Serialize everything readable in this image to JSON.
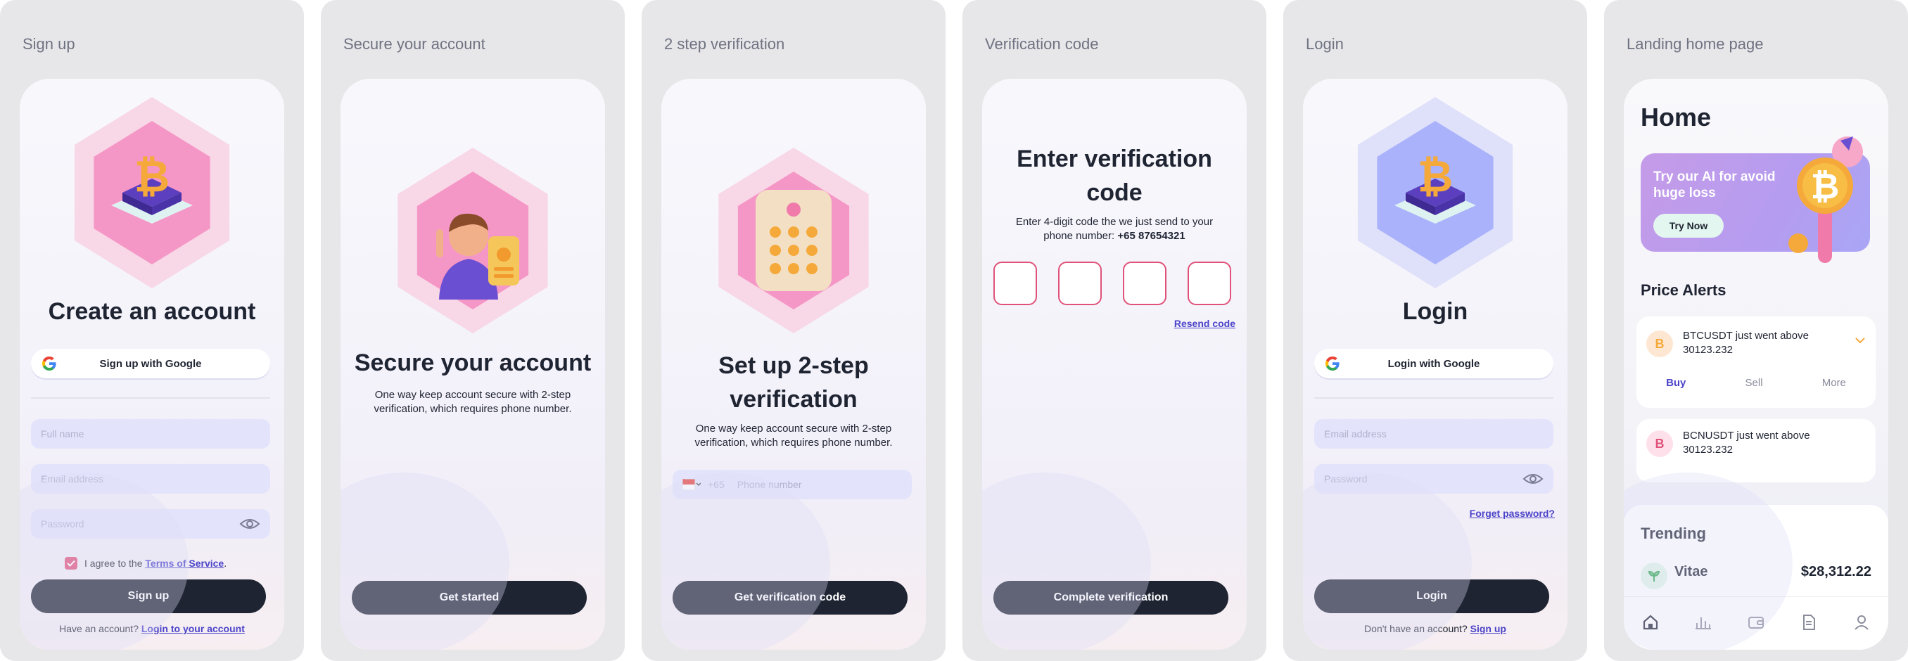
{
  "colors": {
    "accent": "#4b43c9",
    "dark_button": "#1f2432",
    "code_border": "#e0527a",
    "hex_pink": "#f597c6",
    "hex_blue": "#a9b2fb"
  },
  "signup": {
    "panel_title": "Sign up",
    "heading": "Create an account",
    "google_label": "Sign up with Google",
    "fullname_placeholder": "Full name",
    "email_placeholder": "Email address",
    "password_placeholder": "Password",
    "agree_prefix": "I agree to the ",
    "agree_link": "Terms of Service",
    "agree_suffix": ".",
    "agree_checked": true,
    "button": "Sign up",
    "have_account": "Have an account? ",
    "login_link": "Login to your account"
  },
  "secure": {
    "panel_title": "Secure your account",
    "heading": "Secure your account",
    "sub": "One way keep account secure with 2-step verification, which requires phone number.",
    "button": "Get started"
  },
  "twostep": {
    "panel_title": "2 step verification",
    "heading_line1": "Set up 2-step",
    "heading_line2": "verification",
    "sub": "One way keep account secure with 2-step verification, which requires phone number.",
    "country_code": "+65",
    "phone_placeholder": "Phone number",
    "button": "Get verification code"
  },
  "verify": {
    "panel_title": "Verification code",
    "heading_line1": "Enter verification",
    "heading_line2": "code",
    "sub_text": "Enter 4-digit code the we just send to your phone number: ",
    "phone": "+65 87654321",
    "resend": "Resend code",
    "button": "Complete verification"
  },
  "login": {
    "panel_title": "Login",
    "heading": "Login",
    "google_label": "Login with Google",
    "email_placeholder": "Email address",
    "password_placeholder": "Password",
    "forgot": "Forget password?",
    "button": "Login",
    "no_account": "Don't have an account? ",
    "signup_link": "Sign up"
  },
  "home": {
    "panel_title": "Landing home page",
    "title": "Home",
    "promo_text": "Try our AI for avoid huge loss",
    "promo_button": "Try Now",
    "alerts_title": "Price Alerts",
    "alert1": "BTCUSDT just went above 30123.232",
    "alert1_icon": "B",
    "actions": [
      "Buy",
      "Sell",
      "More"
    ],
    "alert2": "BCNUSDT just went above 30123.232",
    "alert2_icon": "B",
    "trending_title": "Trending",
    "trend_name": "Vitae",
    "trend_price": "$28,312.22",
    "nav": [
      "home-icon",
      "chart-icon",
      "wallet-icon",
      "document-icon",
      "profile-icon"
    ]
  }
}
